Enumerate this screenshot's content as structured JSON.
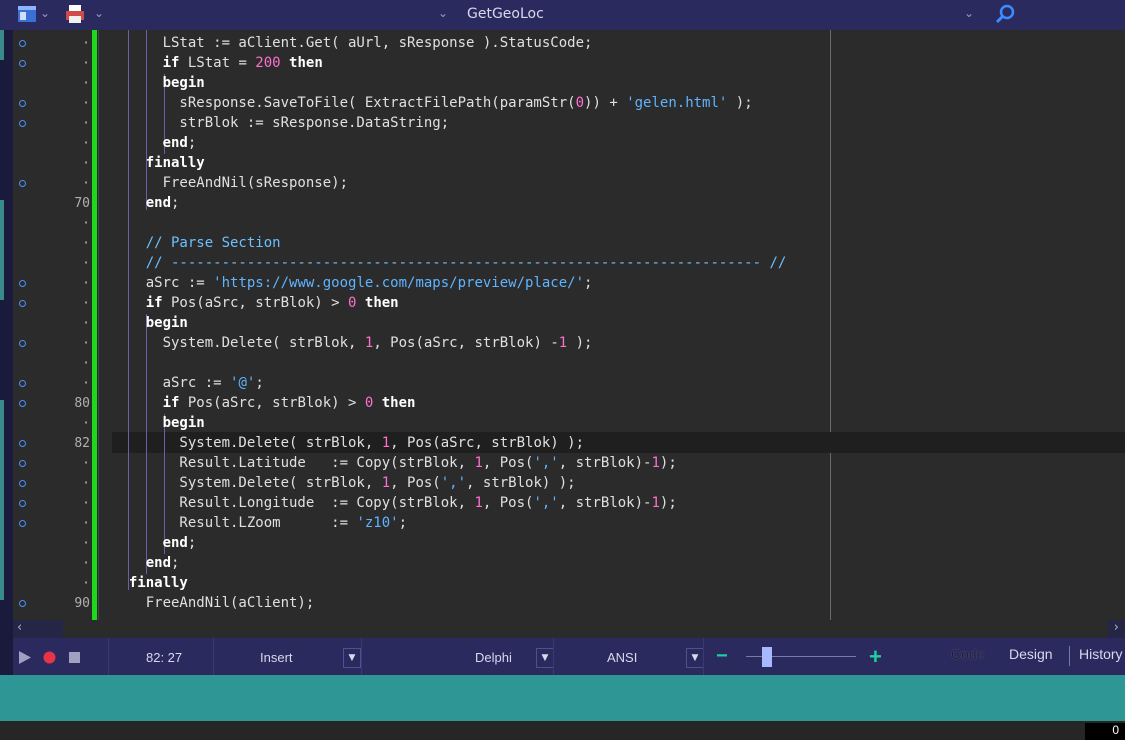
{
  "toolbar": {
    "file_title": "GetGeoLoc",
    "icons": [
      "layout-icon",
      "print-icon",
      "search-icon"
    ]
  },
  "editor": {
    "lines": [
      {
        "num": "",
        "mark": true,
        "code": "      LStat := aClient.Get( aUrl, sResponse ).StatusCode;"
      },
      {
        "num": "",
        "mark": true,
        "code": "      if LStat = 200 then"
      },
      {
        "num": "",
        "mark": false,
        "code": "      begin"
      },
      {
        "num": "",
        "mark": true,
        "code": "        sResponse.SaveToFile( ExtractFilePath(paramStr(0)) + 'gelen.html' );"
      },
      {
        "num": "",
        "mark": true,
        "code": "        strBlok := sResponse.DataString;"
      },
      {
        "num": "",
        "mark": false,
        "code": "      end;"
      },
      {
        "num": "",
        "mark": false,
        "code": "    finally"
      },
      {
        "num": "",
        "mark": true,
        "code": "      FreeAndNil(sResponse);"
      },
      {
        "num": "70",
        "mark": false,
        "code": "    end;"
      },
      {
        "num": "",
        "mark": false,
        "code": ""
      },
      {
        "num": "",
        "mark": false,
        "code": "    // Parse Section"
      },
      {
        "num": "",
        "mark": false,
        "code": "    // ---------------------------------------------------------------------- //"
      },
      {
        "num": "",
        "mark": true,
        "code": "    aSrc := 'https://www.google.com/maps/preview/place/';"
      },
      {
        "num": "",
        "mark": true,
        "code": "    if Pos(aSrc, strBlok) > 0 then"
      },
      {
        "num": "",
        "mark": false,
        "code": "    begin"
      },
      {
        "num": "",
        "mark": true,
        "code": "      System.Delete( strBlok, 1, Pos(aSrc, strBlok) -1 );"
      },
      {
        "num": "",
        "mark": false,
        "code": ""
      },
      {
        "num": "",
        "mark": true,
        "code": "      aSrc := '@';"
      },
      {
        "num": "80",
        "mark": true,
        "code": "      if Pos(aSrc, strBlok) > 0 then"
      },
      {
        "num": "",
        "mark": false,
        "code": "      begin"
      },
      {
        "num": "82",
        "mark": true,
        "code": "        System.Delete( strBlok, 1, Pos(aSrc, strBlok) );"
      },
      {
        "num": "",
        "mark": true,
        "code": "        Result.Latitude   := Copy(strBlok, 1, Pos(',', strBlok)-1);"
      },
      {
        "num": "",
        "mark": true,
        "code": "        System.Delete( strBlok, 1, Pos(',', strBlok) );"
      },
      {
        "num": "",
        "mark": true,
        "code": "        Result.Longitude  := Copy(strBlok, 1, Pos(',', strBlok)-1);"
      },
      {
        "num": "",
        "mark": true,
        "code": "        Result.LZoom      := 'z10';"
      },
      {
        "num": "",
        "mark": false,
        "code": "      end;"
      },
      {
        "num": "",
        "mark": false,
        "code": "    end;"
      },
      {
        "num": "",
        "mark": false,
        "code": "  finally"
      },
      {
        "num": "90",
        "mark": true,
        "code": "    FreeAndNil(aClient);"
      }
    ]
  },
  "statusbar": {
    "position": "82: 27",
    "mode": "Insert",
    "language": "Delphi",
    "encoding": "ANSI",
    "zoom_minus": "−",
    "zoom_plus": "+",
    "tabs": [
      "Code",
      "Design",
      "History"
    ]
  },
  "counter": "0",
  "colors": {
    "keyword": "#ffffff",
    "string": "#5fb4ff",
    "number": "#ff6fd0",
    "comment": "#6cc0ff",
    "change_bar": "#1ed81e"
  }
}
